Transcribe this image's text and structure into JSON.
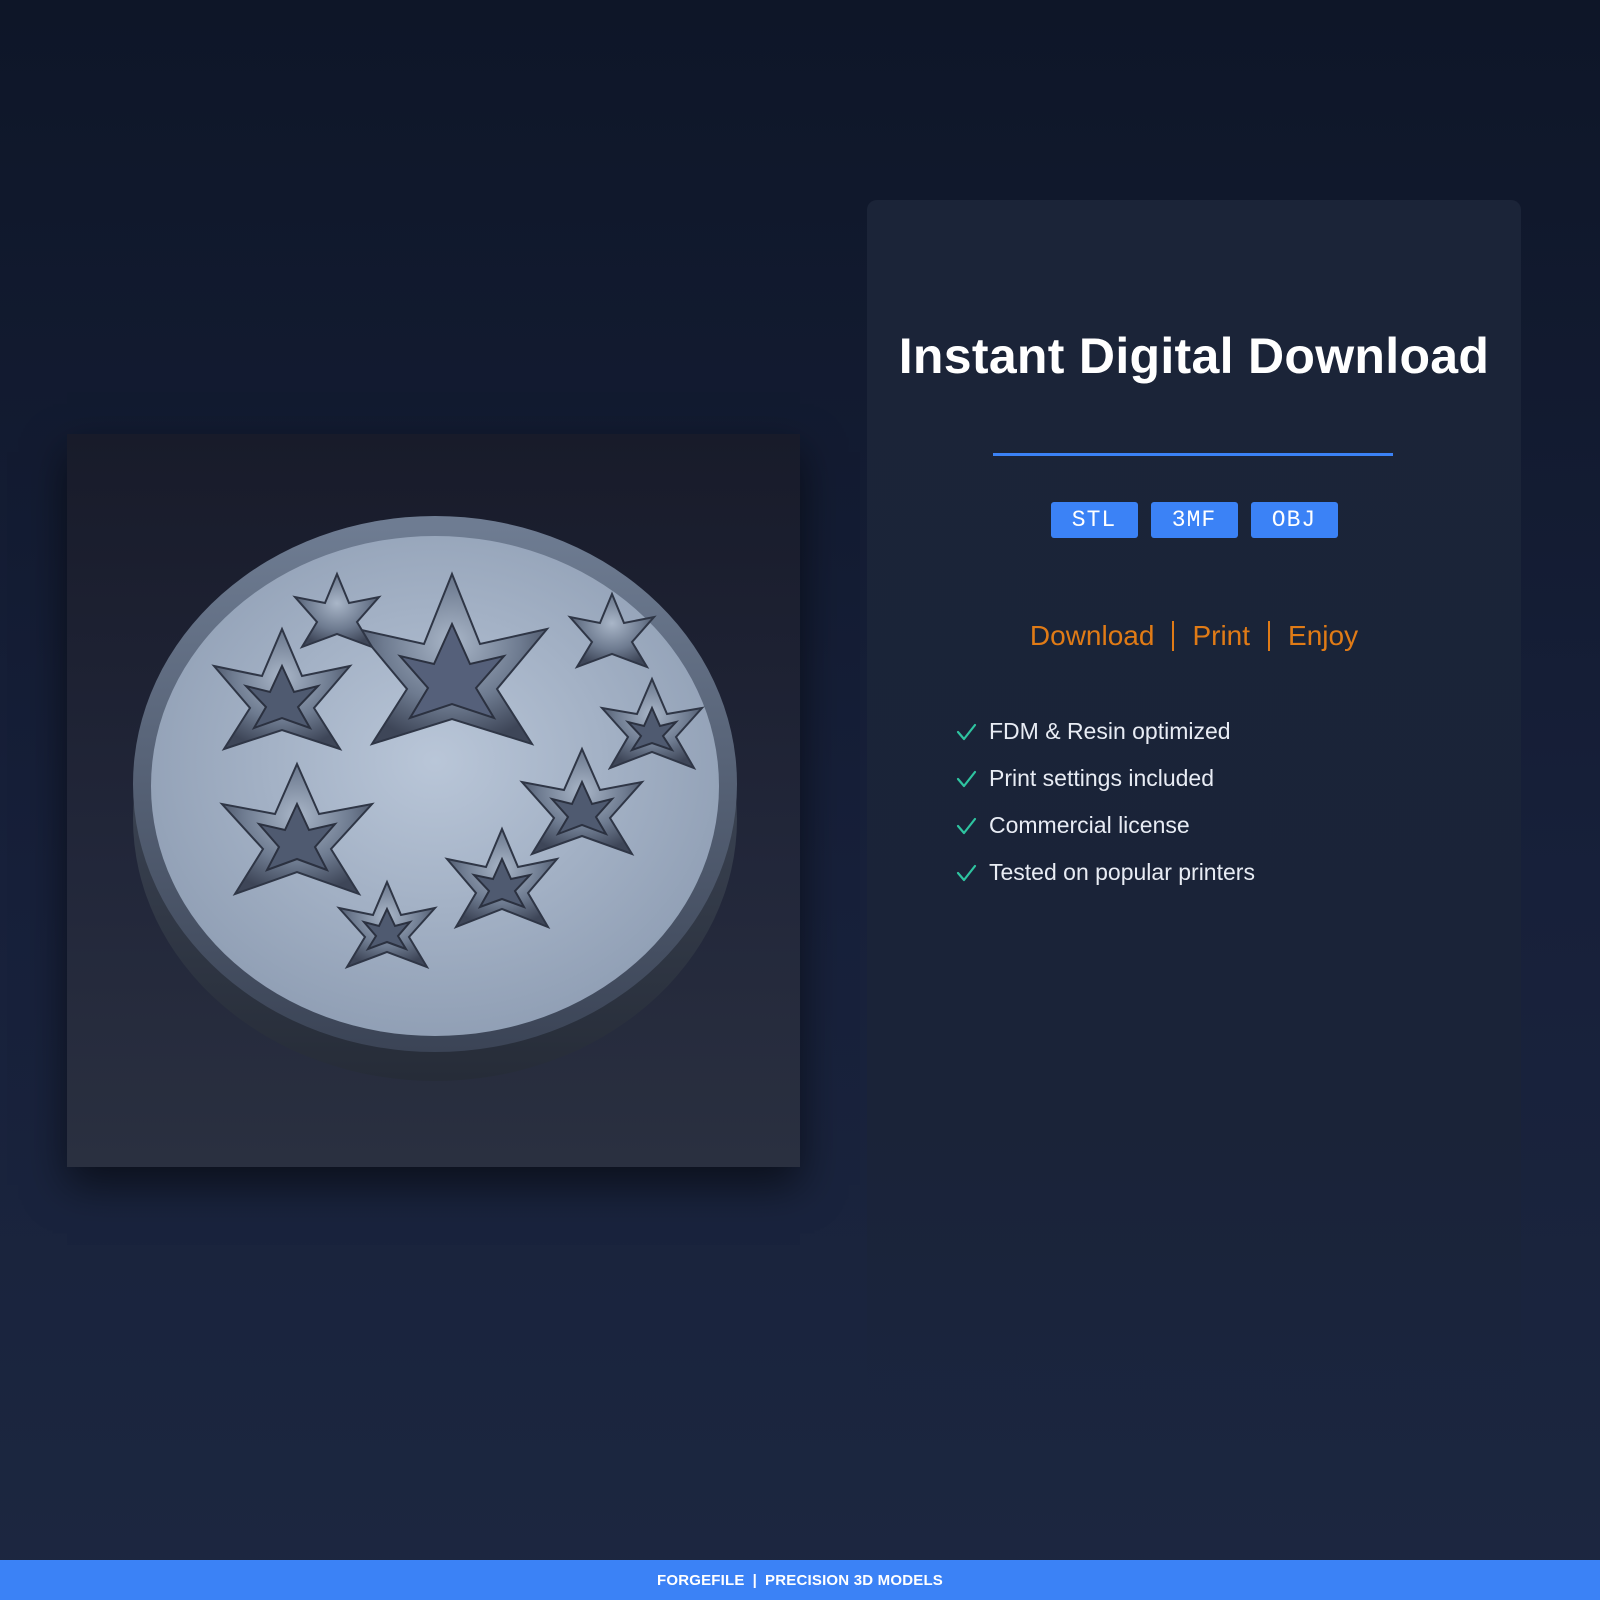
{
  "preview": {
    "image_subject": "3D model render of a round shallow planter bowl filled with succulent rosettes"
  },
  "card": {
    "title": "Instant Digital Download",
    "formats": [
      "STL",
      "3MF",
      "OBJ"
    ],
    "steps": [
      "Download",
      "Print",
      "Enjoy"
    ],
    "features": [
      "FDM & Resin optimized",
      "Print settings included",
      "Commercial license",
      "Tested on popular printers"
    ]
  },
  "footer": {
    "brand": "FORGEFILE",
    "separator": "|",
    "tagline": "PRECISION 3D MODELS"
  },
  "colors": {
    "accent_blue": "#3b82f6",
    "accent_orange": "#e07b16",
    "check_green": "#2ec4a0",
    "background": "#0e1628"
  },
  "icons": {
    "feature": "check-icon"
  }
}
